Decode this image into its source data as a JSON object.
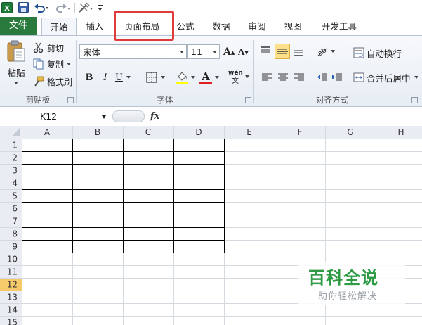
{
  "quick_access": {
    "icons": [
      "excel-logo-icon",
      "save-icon",
      "undo-icon",
      "redo-icon",
      "tool-icon",
      "customize-icon"
    ]
  },
  "tabs": [
    {
      "id": "file",
      "label": "文件"
    },
    {
      "id": "home",
      "label": "开始"
    },
    {
      "id": "insert",
      "label": "插入"
    },
    {
      "id": "page_layout",
      "label": "页面布局"
    },
    {
      "id": "formula",
      "label": "公式"
    },
    {
      "id": "data",
      "label": "数据"
    },
    {
      "id": "review",
      "label": "审阅"
    },
    {
      "id": "view",
      "label": "视图"
    },
    {
      "id": "developer",
      "label": "开发工具"
    }
  ],
  "ribbon": {
    "clipboard": {
      "label": "剪贴板",
      "paste": "粘贴",
      "cut": "剪切",
      "copy": "复制",
      "format_painter": "格式刷"
    },
    "font": {
      "label": "字体",
      "font_name": "宋体",
      "font_size": "11",
      "grow": "A",
      "shrink": "A",
      "bold": "B",
      "italic": "I",
      "underline": "U",
      "phonetic_top": "wén",
      "fill_color": "#ffff00",
      "font_color": "#e02020"
    },
    "alignment": {
      "label": "对齐方式",
      "wrap_text": "自动换行",
      "merge_center": "合并后居中"
    }
  },
  "formula_bar": {
    "name_box": "K12",
    "fx": "fx",
    "formula": ""
  },
  "sheet": {
    "columns": [
      "A",
      "B",
      "C",
      "D",
      "E",
      "F",
      "G",
      "H"
    ],
    "rows": [
      "1",
      "2",
      "3",
      "4",
      "5",
      "6",
      "7",
      "8",
      "9",
      "10",
      "11",
      "12",
      "13",
      "14",
      "15"
    ],
    "selected_row": "12",
    "bordered_range": {
      "columns": [
        "A",
        "B",
        "C",
        "D"
      ],
      "rows": [
        "1",
        "2",
        "3",
        "4",
        "5",
        "6",
        "7",
        "8",
        "9"
      ]
    },
    "header_color": "#e9edf3",
    "selected_header_color": "#f6c96a"
  },
  "watermark": {
    "title": "百科全说",
    "subtitle": "助你轻松解决",
    "color": "#2e9a44"
  },
  "highlight": {
    "target": "page_layout",
    "color": "#e03b3b"
  }
}
